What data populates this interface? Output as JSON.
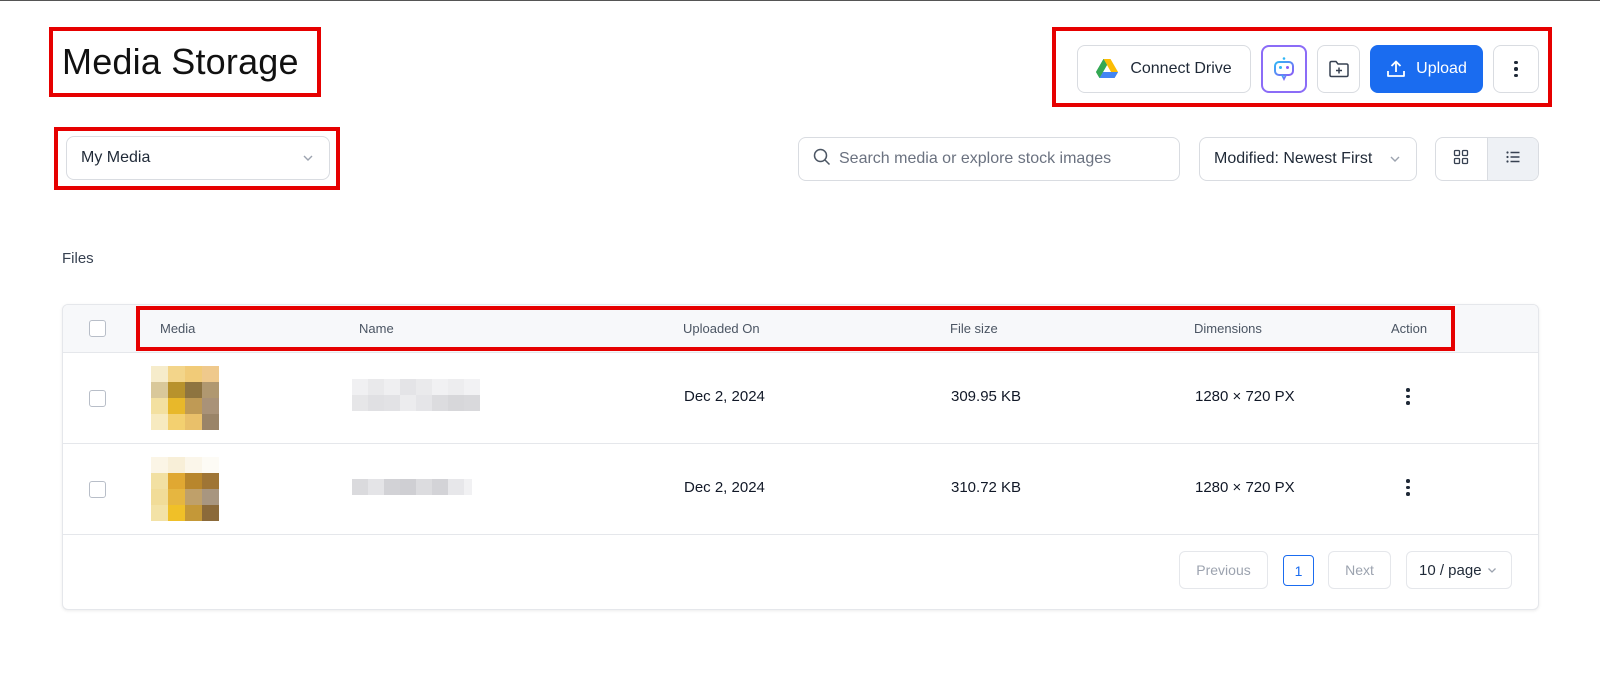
{
  "page": {
    "title": "Media Storage"
  },
  "toolbar": {
    "connect_drive_label": "Connect Drive",
    "upload_label": "Upload"
  },
  "filters": {
    "library_selected": "My Media",
    "search_placeholder": "Search media or explore stock images",
    "sort_selected": "Modified: Newest First",
    "view_mode": "list"
  },
  "section": {
    "label": "Files"
  },
  "table": {
    "columns": [
      "Media",
      "Name",
      "Uploaded On",
      "File size",
      "Dimensions",
      "Action"
    ],
    "rows": [
      {
        "uploaded_on": "Dec 2, 2024",
        "file_size": "309.95 KB",
        "dimensions": "1280 × 720 PX"
      },
      {
        "uploaded_on": "Dec 2, 2024",
        "file_size": "310.72 KB",
        "dimensions": "1280 × 720 PX"
      }
    ]
  },
  "pagination": {
    "previous_label": "Previous",
    "current_page": "1",
    "next_label": "Next",
    "page_size_label": "10 / page"
  },
  "colors": {
    "primary": "#1a6cf0",
    "highlight": "#e60000",
    "ai_border": "#8b6cf7"
  }
}
